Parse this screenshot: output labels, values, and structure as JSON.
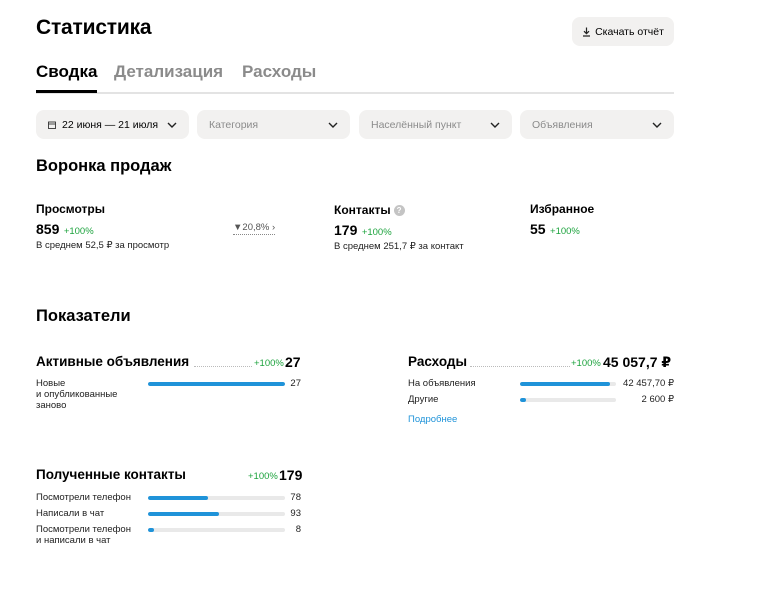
{
  "page": {
    "title": "Статистика",
    "download_label": "Скачать отчёт"
  },
  "tabs": [
    {
      "label": "Сводка",
      "active": true
    },
    {
      "label": "Детализация",
      "active": false
    },
    {
      "label": "Расходы",
      "active": false
    }
  ],
  "filters": {
    "date": "22 июня — 21 июля",
    "category": "Категория",
    "city": "Населённый пункт",
    "ads": "Объявления"
  },
  "funnel": {
    "title": "Воронка продаж",
    "views": {
      "label": "Просмотры",
      "value": "859",
      "delta": "+100%",
      "note": "В среднем 52,5 ₽ за просмотр"
    },
    "conversion": "20,8%",
    "contacts": {
      "label": "Контакты",
      "value": "179",
      "delta": "+100%",
      "note": "В среднем 251,7 ₽ за контакт"
    },
    "favorites": {
      "label": "Избранное",
      "value": "55",
      "delta": "+100%"
    }
  },
  "indicators": {
    "title": "Показатели",
    "active_ads": {
      "title": "Активные объявления",
      "delta": "+100%",
      "value": "27",
      "rows": [
        {
          "label_lines": [
            "Новые",
            "и опубликованные",
            "заново"
          ],
          "value": "27",
          "fraction": 1.0
        }
      ]
    },
    "expenses": {
      "title": "Расходы",
      "delta": "+100%",
      "value": "45 057,7 ₽",
      "rows": [
        {
          "label": "На объявления",
          "value": "42 457,70 ₽",
          "fraction": 0.94
        },
        {
          "label": "Другие",
          "value": "2 600 ₽",
          "fraction": 0.058
        }
      ],
      "more_link": "Подробнее"
    },
    "received_contacts": {
      "title": "Полученные контакты",
      "delta": "+100%",
      "value": "179",
      "rows": [
        {
          "label_lines": [
            "Посмотрели телефон"
          ],
          "value": "78",
          "fraction": 0.436
        },
        {
          "label_lines": [
            "Написали в чат"
          ],
          "value": "93",
          "fraction": 0.52
        },
        {
          "label_lines": [
            "Посмотрели телефон",
            "и написали в чат"
          ],
          "value": "8",
          "fraction": 0.045
        }
      ]
    }
  },
  "colors": {
    "accent_bar": "#1f93d9",
    "positive": "#1da33e"
  }
}
